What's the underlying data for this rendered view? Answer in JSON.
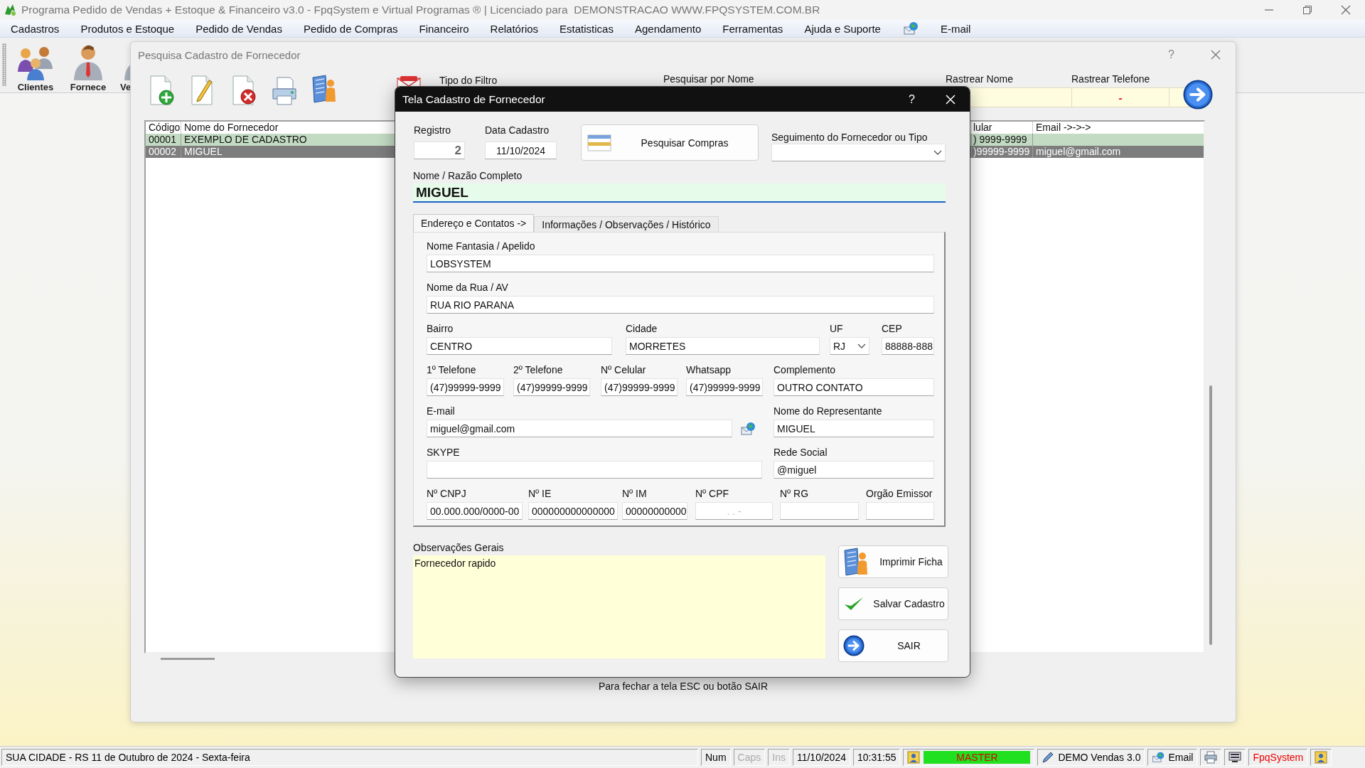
{
  "window": {
    "title": "Programa Pedido de Vendas + Estoque & Financeiro v3.0 - FpqSystem e Virtual Programas ® | Licenciado para  DEMONSTRACAO WWW.FPQSYSTEM.COM.BR"
  },
  "menu": [
    {
      "kind": "text",
      "label": "Cadastros"
    },
    {
      "kind": "text",
      "label": "Produtos e Estoque"
    },
    {
      "kind": "text",
      "label": "Pedido de Vendas"
    },
    {
      "kind": "text",
      "label": "Pedido de Compras"
    },
    {
      "kind": "text",
      "label": "Financeiro"
    },
    {
      "kind": "text",
      "label": "Relatórios"
    },
    {
      "kind": "text",
      "label": "Estatisticas"
    },
    {
      "kind": "text",
      "label": "Agendamento"
    },
    {
      "kind": "text",
      "label": "Ferramentas"
    },
    {
      "kind": "text",
      "label": "Ajuda e Suporte"
    },
    {
      "kind": "icon"
    },
    {
      "kind": "text",
      "label": "E-mail"
    }
  ],
  "launcher": [
    {
      "kind": "people",
      "label": "Clientes"
    },
    {
      "kind": "person",
      "label": "Fornece"
    },
    {
      "kind": "person",
      "label": "Ve"
    }
  ],
  "search_window": {
    "title": "Pesquisa Cadastro de Fornecedor",
    "help": "?",
    "tools": [
      {
        "kind": "new"
      },
      {
        "kind": "edit"
      },
      {
        "kind": "delete"
      },
      {
        "kind": "print"
      },
      {
        "kind": "report"
      }
    ],
    "filter_label": "Tipo do Filtro",
    "name_search_label": "Pesquisar por Nome",
    "track_name": {
      "label": "Rastrear Nome"
    },
    "track_phone": {
      "label": "Rastrear Telefone",
      "value": "-"
    },
    "columns": [
      "Código",
      "Nome do Fornecedor",
      "lular",
      "Email ->->->"
    ],
    "rows": [
      {
        "code": "00001",
        "name": "EXEMPLO DE CADASTRO",
        "phone": ") 9999-9999",
        "selected": false
      },
      {
        "code": "00002",
        "name": "MIGUEL",
        "phone": ")99999-9999",
        "email": "miguel@gmail.com",
        "selected": true
      }
    ],
    "footer": "Para fechar a tela ESC ou botão SAIR"
  },
  "dialog": {
    "title": "Tela Cadastro de Fornecedor",
    "help": "?",
    "record": {
      "label": "Registro",
      "value": "2"
    },
    "date": {
      "label": "Data Cadastro",
      "value": "11/10/2024"
    },
    "search_purchases": "Pesquisar Compras",
    "segment": {
      "label": "Seguimento do Fornecedor ou Tipo"
    },
    "full_name": {
      "label": "Nome / Razão Completo",
      "value": "MIGUEL"
    },
    "tabs": [
      {
        "label": "Endereço e Contatos ->",
        "selected": true
      },
      {
        "label": "Informações / Observações / Histórico",
        "selected": false
      }
    ],
    "field_rows": [
      [
        {
          "kind": "text",
          "label": "Nome Fantasia / Apelido",
          "value": "LOBSYSTEM"
        }
      ],
      [
        {
          "kind": "text",
          "label": "Nome da Rua / AV",
          "value": "RUA RIO PARANA"
        }
      ],
      [
        {
          "kind": "text",
          "label": "Bairro",
          "value": "CENTRO"
        },
        {
          "kind": "text",
          "label": "Cidade",
          "value": "MORRETES"
        },
        {
          "kind": "combo",
          "label": "UF",
          "value": "RJ"
        },
        {
          "kind": "text",
          "label": "CEP",
          "value": "88888-888"
        }
      ],
      [
        {
          "kind": "text",
          "label": "1º Telefone",
          "value": "(47)99999-9999"
        },
        {
          "kind": "text",
          "label": "2º Telefone",
          "value": "(47)99999-9999"
        },
        {
          "kind": "text",
          "label": "Nº Celular",
          "value": "(47)99999-9999"
        },
        {
          "kind": "text",
          "label": "Whatsapp",
          "value": "(47)99999-9999"
        },
        {
          "kind": "text",
          "label": "Complemento",
          "value": "OUTRO CONTATO"
        }
      ],
      [
        {
          "kind": "email",
          "label": "E-mail",
          "value": "miguel@gmail.com"
        },
        {
          "kind": "text",
          "label": "Nome do Representante",
          "value": "MIGUEL"
        }
      ],
      [
        {
          "kind": "text",
          "label": "SKYPE"
        },
        {
          "kind": "text",
          "label": "Rede Social",
          "value": "@miguel"
        }
      ],
      [
        {
          "kind": "text",
          "label": "Nº CNPJ",
          "value": "00.000.000/0000-00"
        },
        {
          "kind": "text",
          "label": "Nº IE",
          "value": "000000000000000"
        },
        {
          "kind": "text",
          "label": "Nº IM",
          "value": "00000000000"
        },
        {
          "kind": "text",
          "label": "Nº CPF",
          "placeholder": ". . -"
        },
        {
          "kind": "text",
          "label": "Nº RG"
        },
        {
          "kind": "text",
          "label": "Orgão Emissor"
        }
      ]
    ],
    "notes": {
      "label": "Observações Gerais",
      "value": "Fornecedor rapido"
    },
    "buttons": [
      {
        "kind": "print",
        "label": "Imprimir Ficha"
      },
      {
        "kind": "save",
        "label": "Salvar Cadastro"
      },
      {
        "kind": "exit",
        "label": "SAIR"
      }
    ]
  },
  "status_bar": {
    "location": "SUA CIDADE - RS 11 de Outubro de 2024 - Sexta-feira",
    "keys": [
      {
        "label": "Num",
        "on": true
      },
      {
        "label": "Caps",
        "on": false
      },
      {
        "label": "Ins",
        "on": false
      }
    ],
    "date": "11/10/2024",
    "time": "10:31:55",
    "user": "MASTER",
    "version": "DEMO Vendas 3.0",
    "email": "Email",
    "brand": "FpqSystem"
  }
}
